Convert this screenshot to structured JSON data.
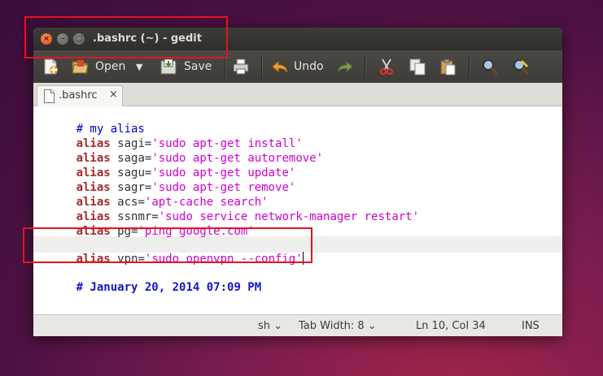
{
  "window": {
    "title": ".bashrc (~) - gedit"
  },
  "toolbar": {
    "open_label": "Open",
    "save_label": "Save",
    "undo_label": "Undo"
  },
  "tabs": [
    {
      "label": ".bashrc",
      "close": "×"
    }
  ],
  "editor": {
    "lines": [
      {
        "type": "comment",
        "text": "# my alias"
      },
      {
        "type": "alias",
        "kw": "alias",
        "name": " sagi=",
        "value": "'sudo apt-get install'"
      },
      {
        "type": "alias",
        "kw": "alias",
        "name": " saga=",
        "value": "'sudo apt-get autoremove'"
      },
      {
        "type": "alias",
        "kw": "alias",
        "name": " sagu=",
        "value": "'sudo apt-get update'"
      },
      {
        "type": "alias",
        "kw": "alias",
        "name": " sagr=",
        "value": "'sudo apt-get remove'"
      },
      {
        "type": "alias",
        "kw": "alias",
        "name": " acs=",
        "value": "'apt-cache search'"
      },
      {
        "type": "alias",
        "kw": "alias",
        "name": " ssnmr=",
        "value": "'sudo service network-manager restart'"
      },
      {
        "type": "alias",
        "kw": "alias",
        "name": " pg=",
        "value": "'ping google.com'"
      },
      {
        "type": "alias",
        "kw": "alias",
        "name": " vpn=",
        "value": "'sudo openvpn --config'"
      },
      {
        "type": "comment",
        "text": "# January 20, 2014 07:09 PM"
      }
    ]
  },
  "statusbar": {
    "language": "sh",
    "tab_width": "Tab Width: 8",
    "position": "Ln 10, Col 34",
    "mode": "INS",
    "chevron": "⌄"
  },
  "colors": {
    "highlight_box": "#e3141e",
    "keyword": "#a52a2a",
    "string": "#d000d0",
    "comment": "#0000d0"
  }
}
